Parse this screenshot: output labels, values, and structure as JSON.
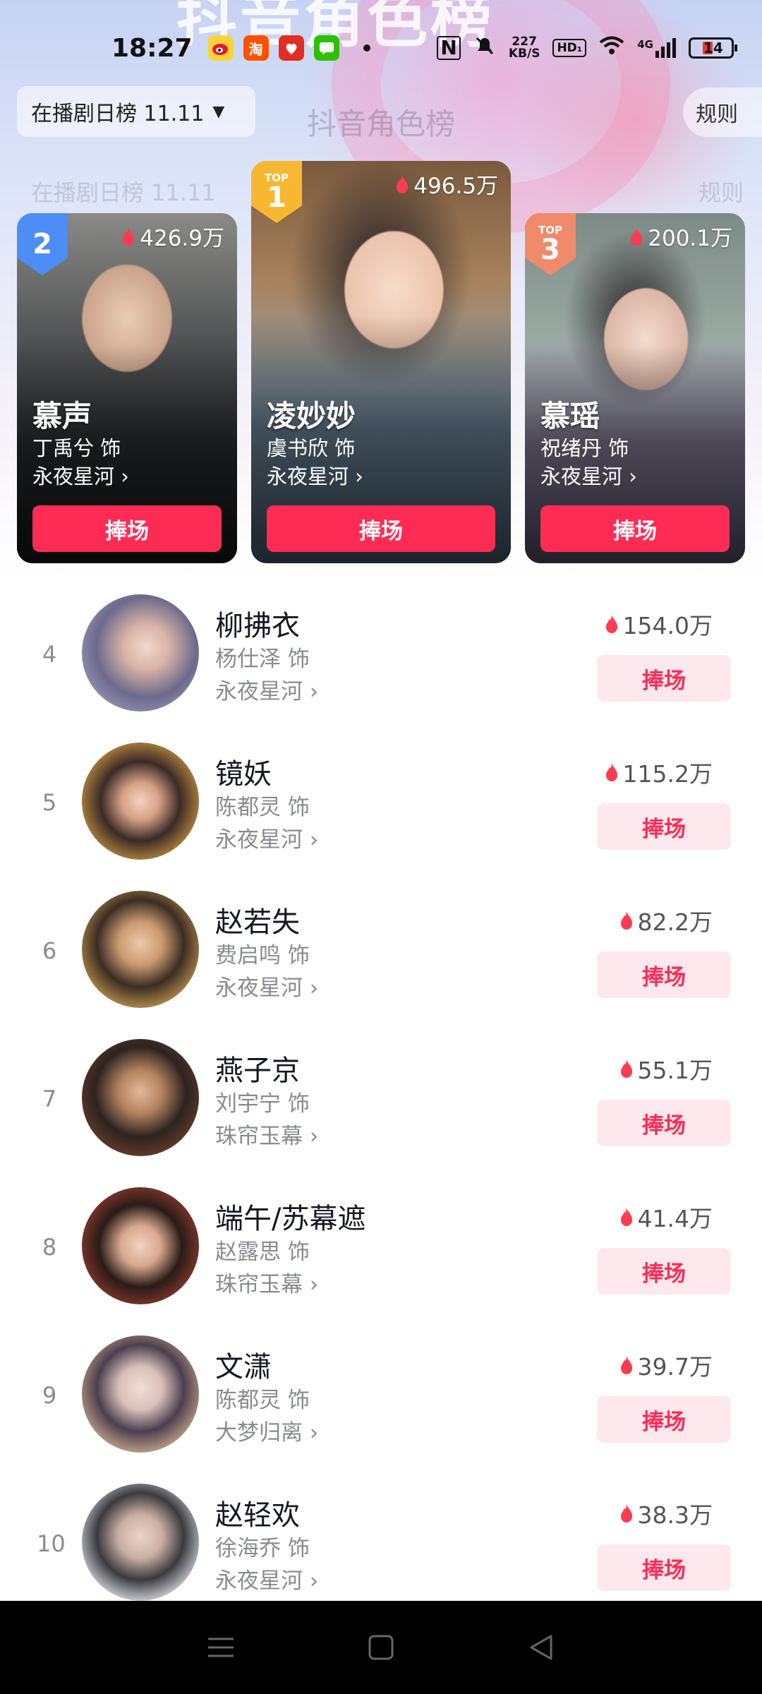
{
  "status_bar": {
    "time": "18:27",
    "net_speed_value": "227",
    "net_speed_unit": "KB/S",
    "hd_label": "HD₁",
    "signal_label": "4G",
    "battery": "14",
    "app_icons": [
      "weibo-icon",
      "taobao-icon",
      "pinduoduo-icon",
      "wechat-icon"
    ]
  },
  "header": {
    "banner_title": "抖音角色榜",
    "page_title": "抖音角色榜",
    "list_selector": "在播剧日榜 11.11",
    "rules_label": "规则",
    "faded_selector": "在播剧日榜 11.11",
    "faded_rules": "规则"
  },
  "colors": {
    "accent": "#fe2c55",
    "accent_light": "#fde8ee",
    "gold": "#f7b731",
    "blue": "#4c8df6",
    "bronze": "#f08a6a"
  },
  "podium": [
    {
      "rank": "1",
      "top_label": "TOP",
      "heat": "496.5万",
      "name": "凌妙妙",
      "actor": "虞书欣 饰",
      "drama": "永夜星河",
      "button": "捧场"
    },
    {
      "rank": "2",
      "heat": "426.9万",
      "name": "慕声",
      "actor": "丁禹兮 饰",
      "drama": "永夜星河",
      "button": "捧场"
    },
    {
      "rank": "3",
      "top_label": "TOP",
      "heat": "200.1万",
      "name": "慕瑶",
      "actor": "祝绪丹 饰",
      "drama": "永夜星河",
      "button": "捧场"
    }
  ],
  "list": [
    {
      "rank": "4",
      "name": "柳拂衣",
      "actor": "杨仕泽 饰",
      "drama": "永夜星河",
      "heat": "154.0万",
      "button": "捧场"
    },
    {
      "rank": "5",
      "name": "镜妖",
      "actor": "陈都灵 饰",
      "drama": "永夜星河",
      "heat": "115.2万",
      "button": "捧场"
    },
    {
      "rank": "6",
      "name": "赵若失",
      "actor": "费启鸣 饰",
      "drama": "永夜星河",
      "heat": "82.2万",
      "button": "捧场"
    },
    {
      "rank": "7",
      "name": "燕子京",
      "actor": "刘宇宁 饰",
      "drama": "珠帘玉幕",
      "heat": "55.1万",
      "button": "捧场"
    },
    {
      "rank": "8",
      "name": "端午/苏幕遮",
      "actor": "赵露思 饰",
      "drama": "珠帘玉幕",
      "heat": "41.4万",
      "button": "捧场"
    },
    {
      "rank": "9",
      "name": "文潇",
      "actor": "陈都灵 饰",
      "drama": "大梦归离",
      "heat": "39.7万",
      "button": "捧场"
    },
    {
      "rank": "10",
      "name": "赵轻欢",
      "actor": "徐海乔 饰",
      "drama": "永夜星河",
      "heat": "38.3万",
      "button": "捧场"
    }
  ]
}
